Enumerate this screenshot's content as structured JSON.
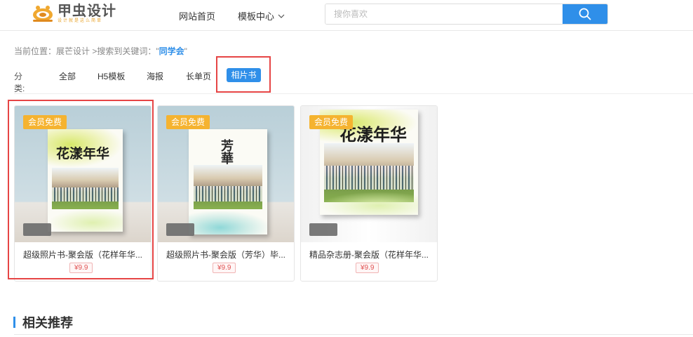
{
  "header": {
    "logo_title": "甲虫设计",
    "logo_slogan": "设计就是这么简单",
    "nav_home": "网站首页",
    "nav_template": "模板中心",
    "search_placeholder": "搜你喜欢",
    "search_value": ""
  },
  "breadcrumb": {
    "prefix": "当前位置：",
    "site": "展芒设计",
    "sep": " >搜索到关键词：",
    "keyword_open": "\"",
    "keyword": "同学会",
    "keyword_close": "\""
  },
  "categories": {
    "label": "分类:",
    "items": [
      "全部",
      "H5模板",
      "海报",
      "长单页",
      "相片书"
    ],
    "active": "相片书"
  },
  "cards": [
    {
      "badge": "会员免费",
      "title": "超级照片书-聚会版（花样年华...",
      "price": "¥9.9",
      "cover_title": "花漾年华",
      "highlighted": true
    },
    {
      "badge": "会员免费",
      "title": "超级照片书-聚会版（芳华）毕...",
      "price": "¥9.9",
      "cover_title": "芳華",
      "highlighted": false
    },
    {
      "badge": "会员免费",
      "title": "精品杂志册-聚会版（花样年华...",
      "price": "¥9.9",
      "cover_title": "花漾年华",
      "highlighted": false
    }
  ],
  "related": {
    "title": "相关推荐"
  },
  "colors": {
    "accent": "#2f8fe9",
    "badge": "#f5b330",
    "highlight": "#e64545",
    "price": "#e05252"
  }
}
